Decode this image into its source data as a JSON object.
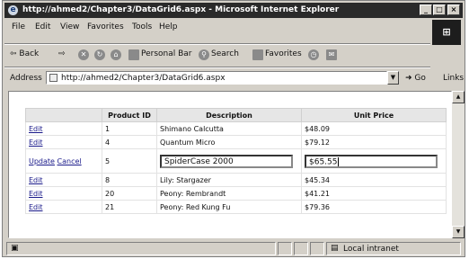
{
  "window": {
    "title": "http://ahmed2/Chapter3/DataGrid6.aspx - Microsoft Internet Explorer"
  },
  "title_buttons": [
    "_",
    "□",
    "×"
  ],
  "menu": [
    "File",
    "Edit",
    "View",
    "Favorites",
    "Tools",
    "Help"
  ],
  "toolbar": {
    "back": "⇦ Back",
    "forward": "⇨",
    "personal_bar": "Personal Bar",
    "search": "Search",
    "favorites": "Favorites"
  },
  "address": {
    "label": "Address",
    "url": "http://ahmed2/Chapter3/DataGrid6.aspx",
    "go": "Go",
    "links": "Links"
  },
  "grid": {
    "headers": [
      "",
      "Product ID",
      "Description",
      "Unit Price"
    ],
    "rows": [
      {
        "action": "Edit",
        "id": "1",
        "description": "Shimano Calcutta",
        "price": "$48.09"
      },
      {
        "action": "Edit",
        "id": "4",
        "description": "Quantum Micro",
        "price": "$79.12"
      },
      {
        "action_update": "Update",
        "action_cancel": "Cancel",
        "id": "5",
        "description": "SpiderCase 2000",
        "price": "$65.55"
      },
      {
        "action": "Edit",
        "id": "8",
        "description": "Lily: Stargazer",
        "price": "$45.34"
      },
      {
        "action": "Edit",
        "id": "20",
        "description": "Peony: Rembrandt",
        "price": "$41.21"
      },
      {
        "action": "Edit",
        "id": "21",
        "description": "Peony: Red Kung Fu",
        "price": "$79.36"
      }
    ]
  },
  "status": {
    "zone": "Local intranet"
  }
}
